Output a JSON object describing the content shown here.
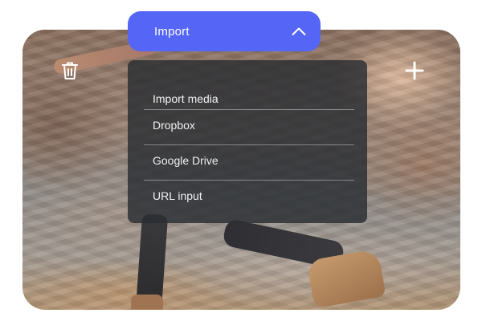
{
  "import_button": {
    "label": "Import",
    "icon": "chevron-up-icon"
  },
  "photo_actions": {
    "delete_icon": "trash-icon",
    "add_icon": "plus-icon"
  },
  "dropdown": {
    "items": [
      {
        "label": "Import media"
      },
      {
        "label": "Dropbox"
      },
      {
        "label": "Google Drive"
      },
      {
        "label": "URL input"
      }
    ]
  },
  "colors": {
    "accent": "#5566f6",
    "menu_background": "#2a2d32",
    "menu_text": "#f1f1f3"
  }
}
